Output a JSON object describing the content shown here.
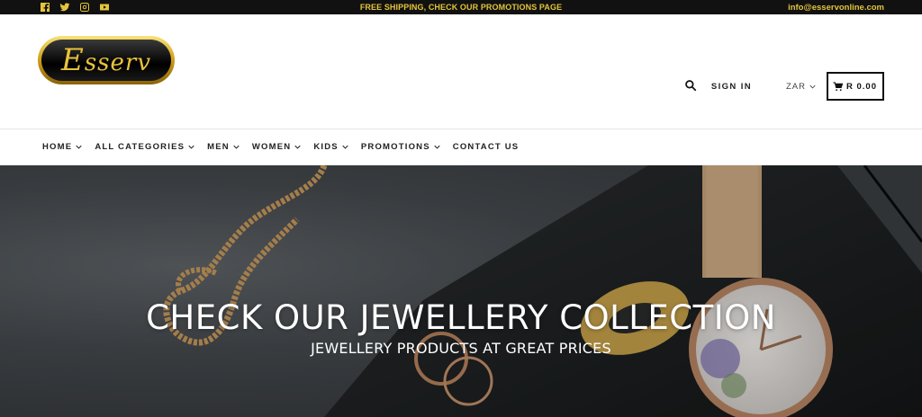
{
  "topbar": {
    "social_icons": [
      "facebook-icon",
      "twitter-icon",
      "instagram-icon",
      "youtube-icon"
    ],
    "promo": "FREE SHIPPING, CHECK OUR PROMOTIONS PAGE",
    "email": "info@esservonline.com",
    "accent_color": "#e3c53a"
  },
  "header": {
    "logo_text_first": "E",
    "logo_text_rest": "sserv",
    "signin": "SIGN IN",
    "currency": "ZAR",
    "cart": "R 0.00"
  },
  "nav": {
    "items": [
      {
        "label": "HOME",
        "dropdown": true
      },
      {
        "label": "ALL CATEGORIES",
        "dropdown": true
      },
      {
        "label": "MEN",
        "dropdown": true
      },
      {
        "label": "WOMEN",
        "dropdown": true
      },
      {
        "label": "KIDS",
        "dropdown": true
      },
      {
        "label": "PROMOTIONS",
        "dropdown": true
      },
      {
        "label": "CONTACT US",
        "dropdown": false
      }
    ]
  },
  "hero": {
    "title": "CHECK OUR JEWELLERY COLLECTION",
    "subtitle": "JEWELLERY PRODUCTS AT GREAT PRICES"
  }
}
